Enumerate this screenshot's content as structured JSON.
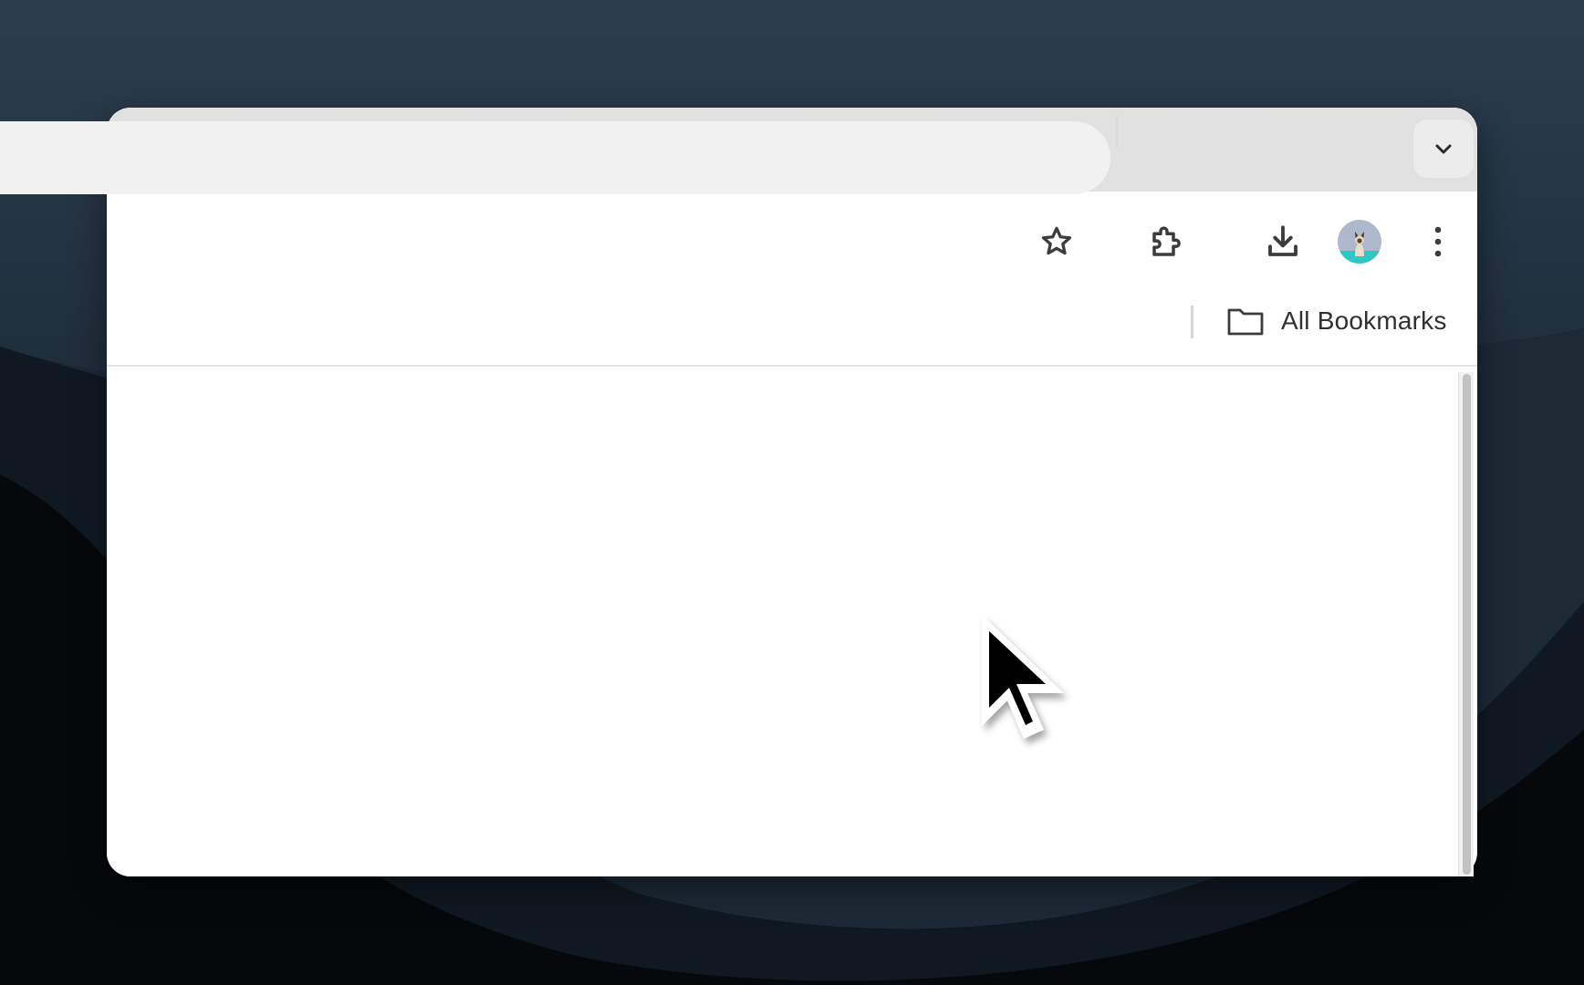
{
  "browser": {
    "tab_strip": {
      "tab_search_icon": "chevron-down-icon"
    },
    "toolbar": {
      "bookmark_icon": "star-outline-icon",
      "extensions_icon": "puzzle-piece-icon",
      "downloads_icon": "download-icon",
      "profile_icon": "avatar",
      "menu_icon": "more-vertical-icon"
    },
    "bookmarks_bar": {
      "folder_icon": "folder-icon",
      "all_bookmarks_label": "All Bookmarks"
    }
  },
  "colors": {
    "tab_strip_bg": "#e1e1e1",
    "omnibox_bg": "#f1f1f1",
    "icon": "#3c3c3c",
    "desktop_top": "#2a3b4b",
    "desktop_bottom": "#050608"
  }
}
